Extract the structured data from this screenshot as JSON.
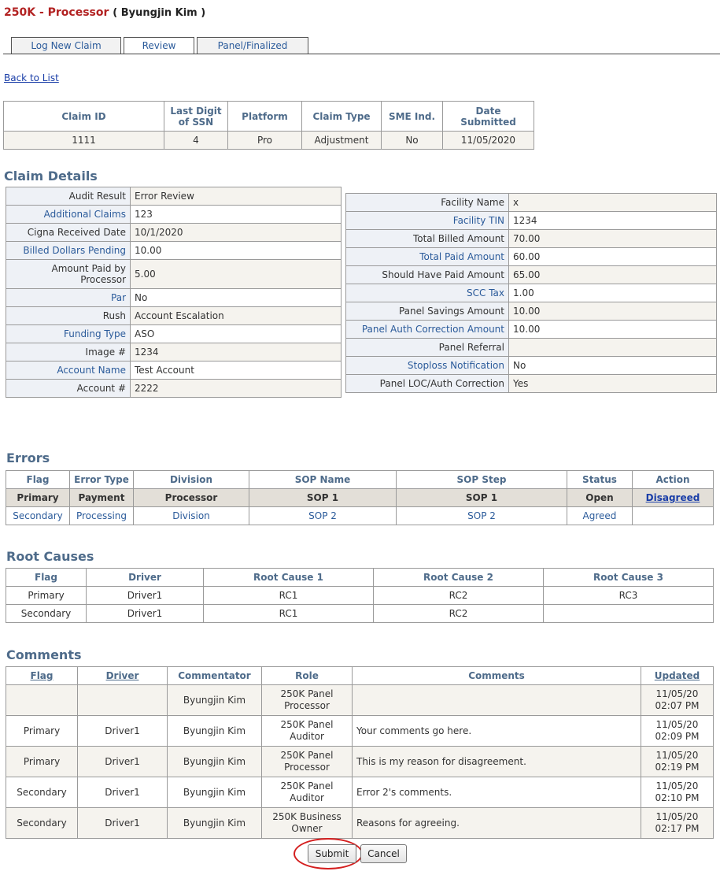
{
  "header": {
    "app": "250K - Processor",
    "user": "( Byungjin Kim )"
  },
  "tabs": [
    {
      "label": "Log New Claim"
    },
    {
      "label": "Review"
    },
    {
      "label": "Panel/Finalized"
    }
  ],
  "back_link": "Back to List",
  "summary": {
    "headers": [
      "Claim ID",
      "Last Digit of SSN",
      "Platform",
      "Claim Type",
      "SME Ind.",
      "Date Submitted"
    ],
    "values": [
      "1111",
      "4",
      "Pro",
      "Adjustment",
      "No",
      "11/05/2020"
    ]
  },
  "claim_details": {
    "title": "Claim Details",
    "left": [
      {
        "label": "Audit Result",
        "value": "Error Review"
      },
      {
        "label": "Additional Claims",
        "value": "123"
      },
      {
        "label": "Cigna Received Date",
        "value": "10/1/2020"
      },
      {
        "label": "Billed Dollars Pending",
        "value": "10.00"
      },
      {
        "label": "Amount Paid by Processor",
        "value": "5.00"
      },
      {
        "label": "Par",
        "value": "No"
      },
      {
        "label": "Rush",
        "value": "Account Escalation"
      },
      {
        "label": "Funding Type",
        "value": "ASO"
      },
      {
        "label": "Image #",
        "value": "1234"
      },
      {
        "label": "Account Name",
        "value": "Test Account"
      },
      {
        "label": "Account #",
        "value": "2222"
      }
    ],
    "right": [
      {
        "label": "Facility Name",
        "value": "x"
      },
      {
        "label": "Facility TIN",
        "value": "1234"
      },
      {
        "label": "Total Billed Amount",
        "value": "70.00"
      },
      {
        "label": "Total Paid Amount",
        "value": "60.00"
      },
      {
        "label": "Should Have Paid Amount",
        "value": "65.00"
      },
      {
        "label": "SCC Tax",
        "value": "1.00"
      },
      {
        "label": "Panel Savings Amount",
        "value": "10.00"
      },
      {
        "label": "Panel Auth Correction Amount",
        "value": "10.00"
      },
      {
        "label": "Panel Referral",
        "value": ""
      },
      {
        "label": "Stoploss Notification",
        "value": "No"
      },
      {
        "label": "Panel LOC/Auth Correction",
        "value": "Yes"
      }
    ]
  },
  "errors": {
    "title": "Errors",
    "headers": [
      "Flag",
      "Error Type",
      "Division",
      "SOP Name",
      "SOP Step",
      "Status",
      "Action"
    ],
    "rows": [
      [
        "Primary",
        "Payment",
        "Processor",
        "SOP 1",
        "SOP 1",
        "Open",
        "Disagreed"
      ],
      [
        "Secondary",
        "Processing",
        "Division",
        "SOP 2",
        "SOP 2",
        "Agreed",
        ""
      ]
    ]
  },
  "root_causes": {
    "title": "Root Causes",
    "headers": [
      "Flag",
      "Driver",
      "Root Cause 1",
      "Root Cause 2",
      "Root Cause 3"
    ],
    "rows": [
      [
        "Primary",
        "Driver1",
        "RC1",
        "RC2",
        "RC3"
      ],
      [
        "Secondary",
        "Driver1",
        "RC1",
        "RC2",
        ""
      ]
    ]
  },
  "comments": {
    "title": "Comments",
    "headers": [
      "Flag",
      "Driver",
      "Commentator",
      "Role",
      "Comments",
      "Updated"
    ],
    "rows": [
      [
        "",
        "",
        "Byungjin Kim",
        "250K Panel Processor",
        "",
        "11/05/20 02:07 PM"
      ],
      [
        "Primary",
        "Driver1",
        "Byungjin Kim",
        "250K Panel Auditor",
        "Your comments go here.",
        "11/05/20 02:09 PM"
      ],
      [
        "Primary",
        "Driver1",
        "Byungjin Kim",
        "250K Panel Processor",
        "This is my reason for disagreement.",
        "11/05/20 02:19 PM"
      ],
      [
        "Secondary",
        "Driver1",
        "Byungjin Kim",
        "250K Panel Auditor",
        "Error 2's comments.",
        "11/05/20 02:10 PM"
      ],
      [
        "Secondary",
        "Driver1",
        "Byungjin Kim",
        "250K Business Owner",
        "Reasons for agreeing.",
        "11/05/20 02:17 PM"
      ]
    ]
  },
  "buttons": {
    "submit": "Submit",
    "cancel": "Cancel"
  },
  "colors": {
    "title_red": "#b22222",
    "section_blue": "#4e6b8a",
    "link_blue": "#1a3ea8",
    "highlight_circle": "#d41f1f"
  }
}
